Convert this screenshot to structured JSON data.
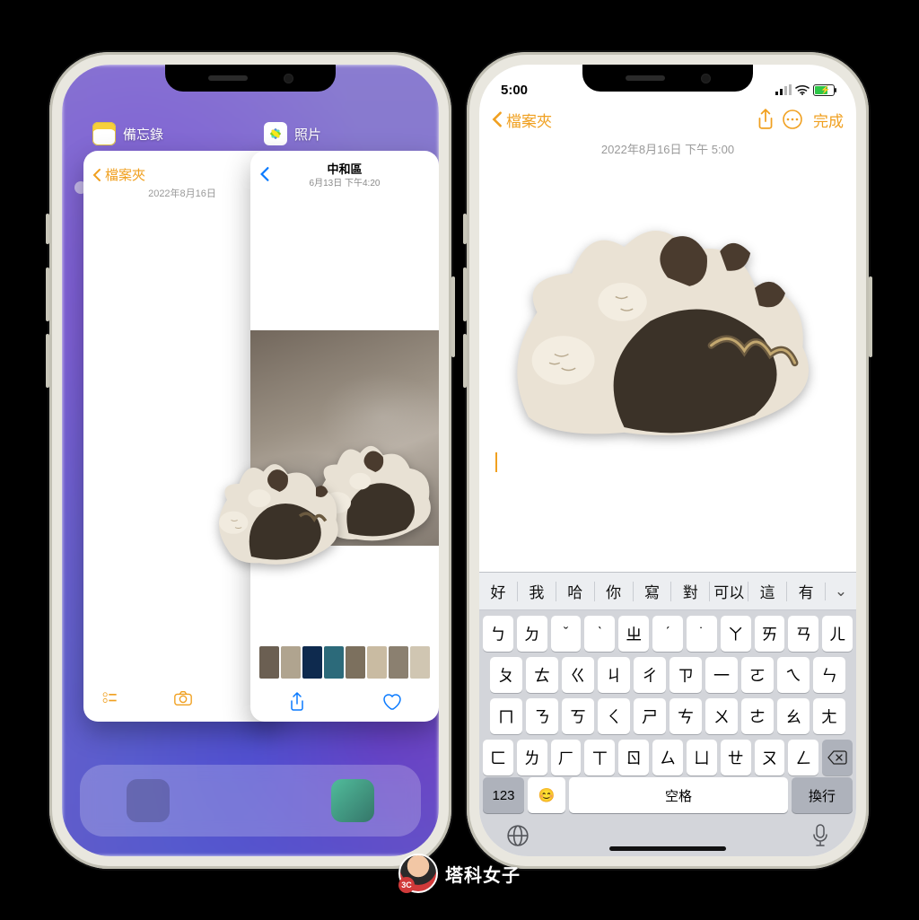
{
  "switcher": {
    "apps": {
      "notes": "備忘錄",
      "photos": "照片"
    },
    "notes_card": {
      "back": "檔案夾",
      "date": "2022年8月16日"
    },
    "photos_card": {
      "title": "中和區",
      "subtitle": "6月13日 下午4:20"
    }
  },
  "notes": {
    "time": "5:00",
    "back": "檔案夾",
    "done": "完成",
    "date": "2022年8月16日 下午 5:00"
  },
  "keyboard": {
    "suggestions": [
      "好",
      "我",
      "哈",
      "你",
      "寫",
      "對",
      "可以",
      "這",
      "有"
    ],
    "row1": [
      "ㄅ",
      "ㄉ",
      "ˇ",
      "ˋ",
      "ㄓ",
      "ˊ",
      "˙",
      "ㄚ",
      "ㄞ",
      "ㄢ",
      "ㄦ"
    ],
    "row2": [
      "ㄆ",
      "ㄊ",
      "ㄍ",
      "ㄐ",
      "ㄔ",
      "ㄗ",
      "一",
      "ㄛ",
      "ㄟ",
      "ㄣ"
    ],
    "row3": [
      "ㄇ",
      "ㄋ",
      "ㄎ",
      "ㄑ",
      "ㄕ",
      "ㄘ",
      "ㄨ",
      "ㄜ",
      "ㄠ",
      "ㄤ"
    ],
    "row4": [
      "ㄈ",
      "ㄌ",
      "ㄏ",
      "ㄒ",
      "ㄖ",
      "ㄙ",
      "ㄩ",
      "ㄝ",
      "ㄡ",
      "ㄥ"
    ],
    "num": "123",
    "space": "空格",
    "ret": "換行"
  },
  "watermark": {
    "badge": "3C",
    "text": "塔科女子"
  }
}
